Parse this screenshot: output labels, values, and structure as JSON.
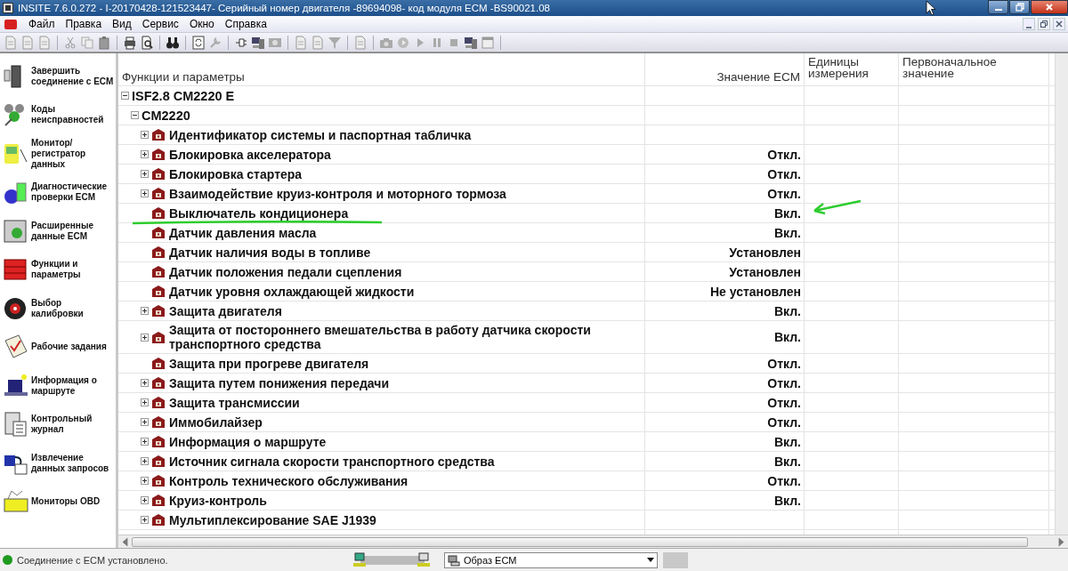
{
  "window": {
    "title": "INSITE 7.6.0.272  - I-20170428-121523447- Серийный номер двигателя -89694098- код модуля ECM -BS90021.08"
  },
  "menu": [
    "Файл",
    "Правка",
    "Вид",
    "Сервис",
    "Окно",
    "Справка"
  ],
  "sidebar": {
    "items": [
      {
        "label": "Завершить соединение с ECM"
      },
      {
        "label": "Коды неисправностей"
      },
      {
        "label": "Монитор/регистратор данных"
      },
      {
        "label": "Диагностические проверки ECM"
      },
      {
        "label": "Расширенные данные ECM"
      },
      {
        "label": "Функции и параметры"
      },
      {
        "label": "Выбор калибровки"
      },
      {
        "label": "Рабочие задания"
      },
      {
        "label": "Информация о маршруте"
      },
      {
        "label": "Контрольный журнал"
      },
      {
        "label": "Извлечение данных запросов"
      },
      {
        "label": "Мониторы OBD"
      }
    ]
  },
  "table": {
    "columns": [
      "Функции и параметры",
      "Значение ECM",
      "Единицы измерения",
      "Первоначальное значение"
    ],
    "tree": [
      {
        "label": "ISF2.8 CM2220 E",
        "kind": "node",
        "expanded": true,
        "children": [
          {
            "label": "CM2220",
            "kind": "node",
            "expanded": true,
            "children": [
              {
                "label": "Идентификатор системы и паспортная табличка",
                "kind": "node",
                "expanded": false,
                "marked": false
              },
              {
                "label": "Блокировка акселератора",
                "value": "Откл.",
                "kind": "node",
                "expanded": false,
                "marked": false
              },
              {
                "label": "Блокировка стартера",
                "value": "Откл.",
                "kind": "node",
                "expanded": false,
                "marked": false
              },
              {
                "label": "Взаимодействие круиз-контроля и моторного тормоза",
                "value": "Откл.",
                "kind": "node",
                "expanded": false,
                "marked": false
              },
              {
                "label": "Выключатель кондиционера",
                "value": "Вкл.",
                "kind": "leaf",
                "marked": true
              },
              {
                "label": "Датчик давления масла",
                "value": "Вкл.",
                "kind": "leaf",
                "marked": false
              },
              {
                "label": "Датчик наличия воды в топливе",
                "value": "Установлен",
                "kind": "leaf",
                "marked": false
              },
              {
                "label": "Датчик положения педали сцепления",
                "value": "Установлен",
                "kind": "leaf",
                "marked": false
              },
              {
                "label": "Датчик уровня охлаждающей жидкости",
                "value": "Не установлен",
                "kind": "leaf",
                "marked": false
              },
              {
                "label": "Защита двигателя",
                "value": "Вкл.",
                "kind": "node",
                "expanded": false,
                "marked": false
              },
              {
                "label": "Защита от постороннего вмешательства в работу датчика скорости транспортного средства",
                "value": "Вкл.",
                "kind": "node",
                "expanded": false,
                "marked": false
              },
              {
                "label": "Защита при прогреве двигателя",
                "value": "Откл.",
                "kind": "leaf",
                "marked": false
              },
              {
                "label": "Защита путем понижения передачи",
                "value": "Откл.",
                "kind": "node",
                "expanded": false,
                "marked": false
              },
              {
                "label": "Защита трансмиссии",
                "value": "Откл.",
                "kind": "node",
                "expanded": false,
                "marked": false
              },
              {
                "label": "Иммобилайзер",
                "value": "Откл.",
                "kind": "node",
                "expanded": false,
                "marked": false
              },
              {
                "label": "Информация о маршруте",
                "value": "Вкл.",
                "kind": "node",
                "expanded": false,
                "marked": false
              },
              {
                "label": "Источник сигнала скорости транспортного средства",
                "value": "Вкл.",
                "kind": "node",
                "expanded": false,
                "marked": false
              },
              {
                "label": "Контроль технического обслуживания",
                "value": "Откл.",
                "kind": "node",
                "expanded": false,
                "marked": false
              },
              {
                "label": "Круиз-контроль",
                "value": "Вкл.",
                "kind": "node",
                "expanded": false,
                "marked": false
              },
              {
                "label": "Мультиплексирование SAE J1939",
                "kind": "node",
                "expanded": false,
                "marked": false
              }
            ]
          }
        ]
      }
    ]
  },
  "status_bar": {
    "text": "Соединение с ECM установлено.",
    "connected": true,
    "source": "Образ ECM"
  }
}
